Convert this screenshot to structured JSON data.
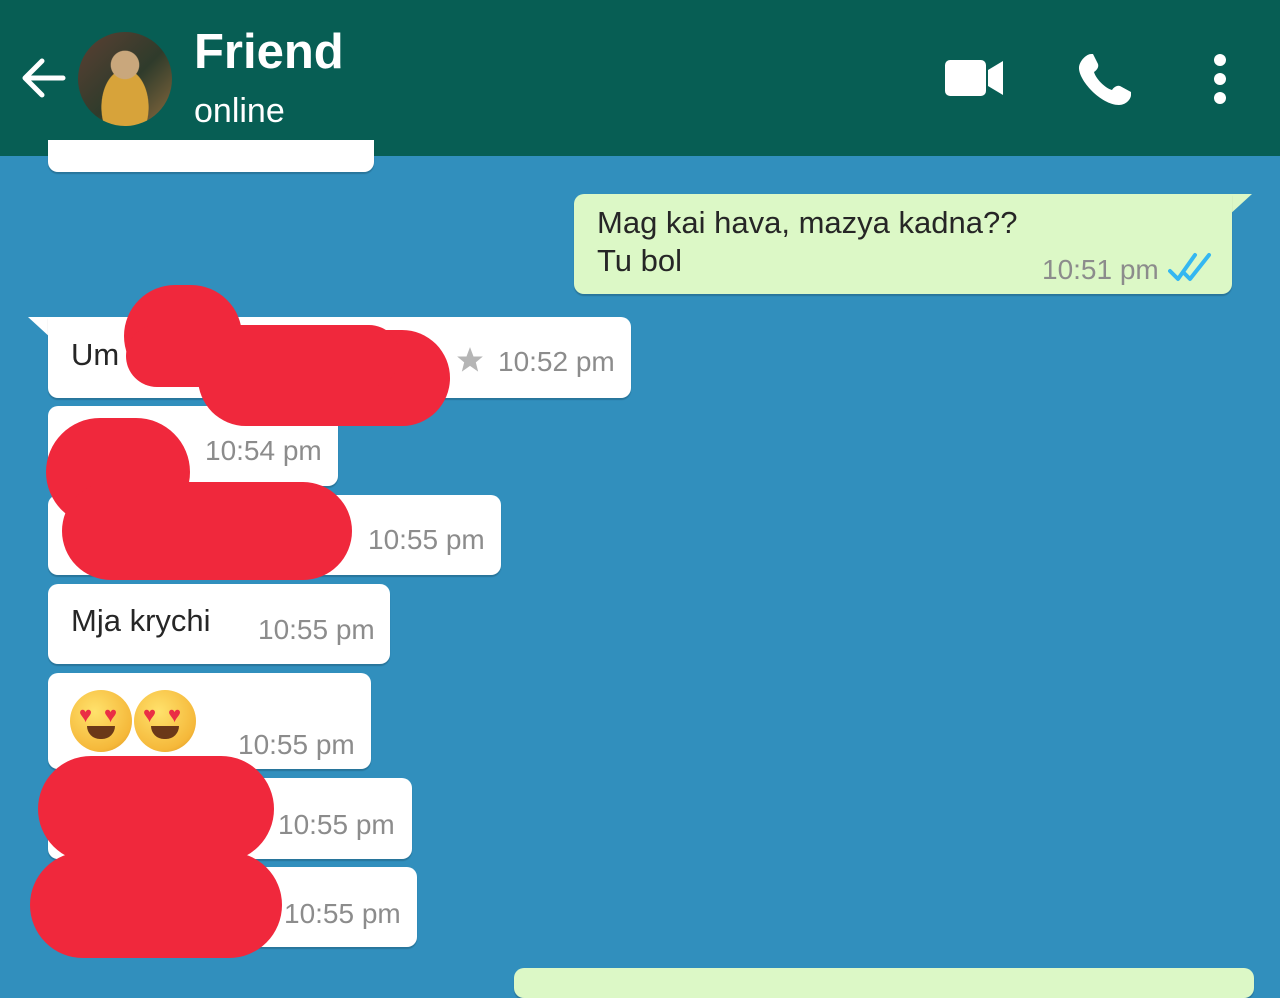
{
  "header": {
    "contact_name": "Friend",
    "status": "online",
    "icons": [
      "back-arrow-icon",
      "avatar",
      "video-call-icon",
      "phone-icon",
      "more-vert-icon"
    ],
    "color": "#075e54"
  },
  "messages": [
    {
      "direction": "out",
      "lines": [
        "Mag kai hava, mazya kadna??",
        "Tu bol"
      ],
      "time": "10:51 pm",
      "read": true
    },
    {
      "direction": "in",
      "text": "Um",
      "time": "10:52 pm",
      "starred": true,
      "redacted": true
    },
    {
      "direction": "in",
      "text": "",
      "time": "10:54 pm",
      "redacted": true
    },
    {
      "direction": "in",
      "text": "",
      "time": "10:55 pm",
      "redacted": true
    },
    {
      "direction": "in",
      "text": "Mja krychi",
      "time": "10:55 pm"
    },
    {
      "direction": "in",
      "emoji": "😍😍",
      "time": "10:55 pm"
    },
    {
      "direction": "in",
      "text": "",
      "time": "10:55 pm",
      "redacted": true
    },
    {
      "direction": "in",
      "text": "",
      "time": "10:55 pm",
      "redacted": true
    }
  ],
  "colors": {
    "chat_background": "#318fbd",
    "outgoing_bubble": "#dcf8c6",
    "incoming_bubble": "#ffffff",
    "redaction": "#f0283c"
  }
}
